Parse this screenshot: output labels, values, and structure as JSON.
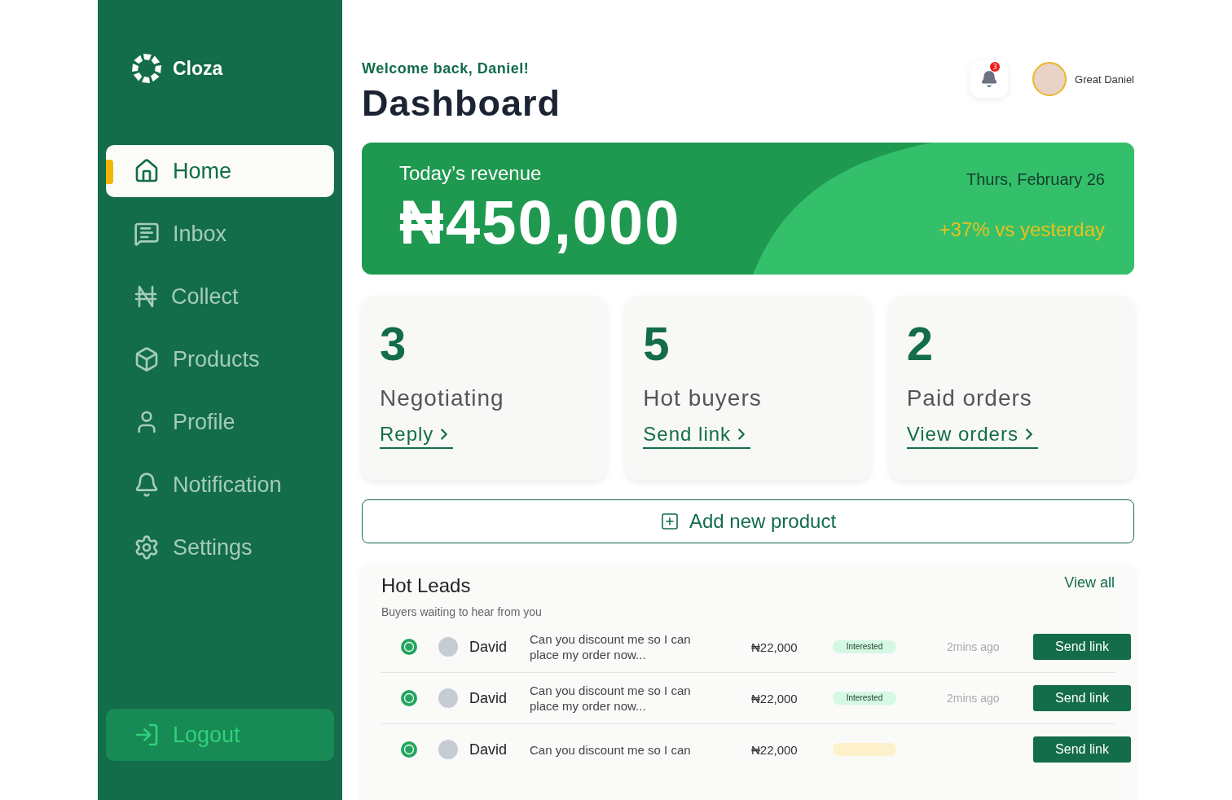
{
  "brand": {
    "name": "Cloza"
  },
  "sidebar": {
    "items": [
      {
        "label": "Home",
        "kind": "home",
        "selected": true
      },
      {
        "label": "Inbox",
        "kind": "inbox",
        "selected": false
      },
      {
        "label": "Collect",
        "kind": "naira",
        "selected": false
      },
      {
        "label": "Products",
        "kind": "box",
        "selected": false
      },
      {
        "label": "Profile",
        "kind": "user",
        "selected": false
      },
      {
        "label": "Notification",
        "kind": "bell",
        "selected": false
      },
      {
        "label": "Settings",
        "kind": "gear",
        "selected": false
      }
    ],
    "logout": "Logout"
  },
  "header": {
    "greeting": "Welcome back, Daniel!",
    "title": "Dashboard",
    "notification_count": "3",
    "user_name": "Great Daniel"
  },
  "revenue": {
    "label": "Today’s revenue",
    "amount": "₦450,000",
    "date": "Thurs, February 26",
    "change": "+37% vs yesterday"
  },
  "stats": [
    {
      "value": "3",
      "label": "Negotiating",
      "link": "Reply"
    },
    {
      "value": "5",
      "label": "Hot buyers",
      "link": "Send link"
    },
    {
      "value": "2",
      "label": "Paid orders",
      "link": "View orders"
    }
  ],
  "add_button": "Add new product",
  "hot_leads": {
    "title": "Hot Leads",
    "subtitle": "Buyers waiting to hear from you",
    "view_all": "View all",
    "rows": [
      {
        "name": "David",
        "message": "Can you discount me so I can place my order now...",
        "price": "₦22,000",
        "status": "Interested",
        "color": "#d4f8e3",
        "time": "2mins ago",
        "action": "Send link"
      },
      {
        "name": "David",
        "message": "Can you discount me so I can place my order now...",
        "price": "₦22,000",
        "status": "Interested",
        "color": "#d4f8e3",
        "time": "2mins ago",
        "action": "Send link"
      },
      {
        "name": "David",
        "message": "Can you discount me so I can",
        "price": "₦22,000",
        "color": "#fdf1cc",
        "action": "Send link"
      }
    ]
  }
}
